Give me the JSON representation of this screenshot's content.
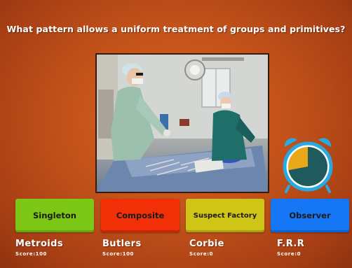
{
  "question": "What pattern allows a uniform treatment of groups and primitives?",
  "answers": [
    {
      "label": "Singleton",
      "color": "#7dc816"
    },
    {
      "label": "Composite",
      "color": "#f23008"
    },
    {
      "label": "Suspect Factory",
      "color": "#cfc516"
    },
    {
      "label": "Observer",
      "color": "#1577f5"
    }
  ],
  "players": [
    {
      "name": "Metroids",
      "score": "Score:100"
    },
    {
      "name": "Butlers",
      "score": "Score:100"
    },
    {
      "name": "Corbie",
      "score": "Score:0"
    },
    {
      "name": "F.R.R",
      "score": "Score:0"
    }
  ],
  "timer": {
    "icon": "alarm-clock-icon",
    "remaining_fraction": 0.72,
    "elapsed_color": "#e8a81a",
    "remaining_color": "#1f5a5e",
    "ring_color": "#29a9e1"
  },
  "theme": {
    "background": "#c2521a"
  }
}
